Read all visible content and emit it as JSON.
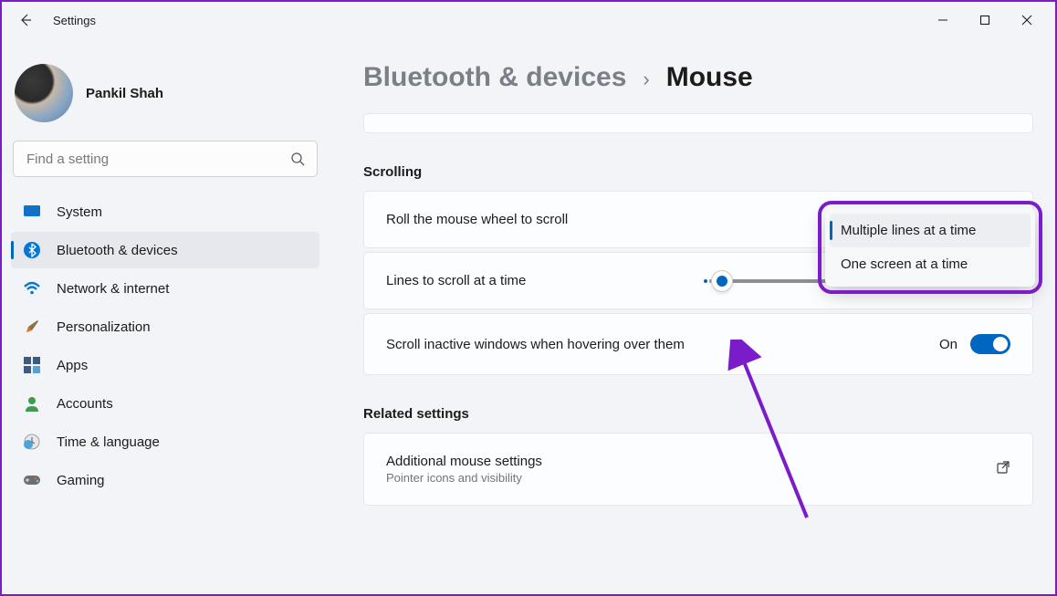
{
  "appTitle": "Settings",
  "user": {
    "name": "Pankil Shah"
  },
  "search": {
    "placeholder": "Find a setting"
  },
  "sidebar": {
    "items": [
      {
        "label": "System"
      },
      {
        "label": "Bluetooth & devices"
      },
      {
        "label": "Network & internet"
      },
      {
        "label": "Personalization"
      },
      {
        "label": "Apps"
      },
      {
        "label": "Accounts"
      },
      {
        "label": "Time & language"
      },
      {
        "label": "Gaming"
      }
    ]
  },
  "breadcrumb": {
    "parent": "Bluetooth & devices",
    "sep": "›",
    "current": "Mouse"
  },
  "sections": {
    "scrolling": {
      "heading": "Scrolling",
      "roll": {
        "label": "Roll the mouse wheel to scroll"
      },
      "dropdown": {
        "options": [
          "Multiple lines at a time",
          "One screen at a time"
        ],
        "selectedIndex": 0
      },
      "lines": {
        "label": "Lines to scroll at a time"
      },
      "inactive": {
        "label": "Scroll inactive windows when hovering over them",
        "state": "On"
      }
    },
    "related": {
      "heading": "Related settings",
      "additional": {
        "title": "Additional mouse settings",
        "sub": "Pointer icons and visibility"
      }
    }
  }
}
